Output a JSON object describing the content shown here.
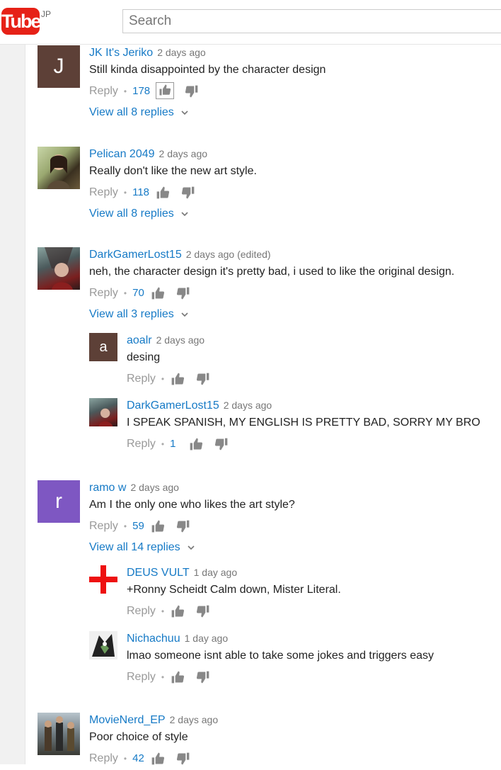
{
  "header": {
    "logo_text": "Tube",
    "region": "JP",
    "search_placeholder": "Search"
  },
  "colors": {
    "brand": "#e62117",
    "link": "#167ac6",
    "meta": "#777777"
  },
  "comments": [
    {
      "author": "JK It's Jeriko",
      "time": "2 days ago",
      "text": "Still kinda disappointed by the character design",
      "reply_label": "Reply",
      "likes": "178",
      "view_replies": "View all 8 replies",
      "avatar_letter": "J",
      "avatar_color": "#5d4037"
    },
    {
      "author": "Pelican 2049",
      "time": "2 days ago",
      "text": "Really don't like the new art style.",
      "reply_label": "Reply",
      "likes": "118",
      "view_replies": "View all 8 replies"
    },
    {
      "author": "DarkGamerLost15",
      "time": "2 days ago (edited)",
      "text": "neh, the character design it's pretty bad, i used to like the original design.",
      "reply_label": "Reply",
      "likes": "70",
      "view_replies": "View all 3 replies"
    },
    {
      "author": "aoalr",
      "time": "2 days ago",
      "text": "desing",
      "reply_label": "Reply",
      "avatar_letter": "a",
      "avatar_color": "#5d4037"
    },
    {
      "author": "DarkGamerLost15",
      "time": "2 days ago",
      "text": "I SPEAK SPANISH, MY ENGLISH IS PRETTY BAD, SORRY MY BRO",
      "reply_label": "Reply",
      "likes": "1"
    },
    {
      "author": "ramo w",
      "time": "2 days ago",
      "text": "Am I the only one who likes the art style?",
      "reply_label": "Reply",
      "likes": "59",
      "view_replies": "View all 14 replies",
      "avatar_letter": "r",
      "avatar_color": "#7e57c2"
    },
    {
      "author": "DEUS VULT",
      "time": "1 day ago",
      "text": "+Ronny Scheidt Calm down, Mister Literal.",
      "reply_label": "Reply"
    },
    {
      "author": "Nichachuu",
      "time": "1 day ago",
      "text": "lmao someone isnt able to take some jokes and triggers easy",
      "reply_label": "Reply"
    },
    {
      "author": "MovieNerd_EP",
      "time": "2 days ago",
      "text": "Poor choice of style",
      "reply_label": "Reply",
      "likes": "42"
    }
  ]
}
